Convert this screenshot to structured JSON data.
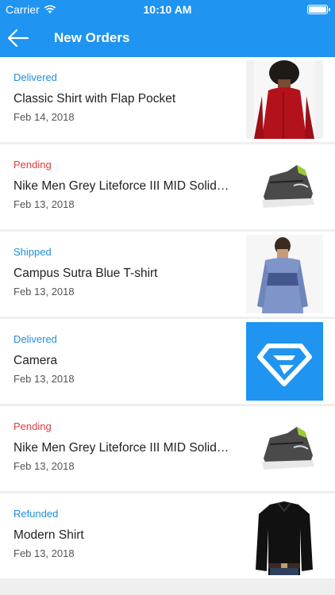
{
  "status_bar": {
    "carrier": "Carrier",
    "time": "10:10 AM"
  },
  "header": {
    "title": "New Orders"
  },
  "colors": {
    "accent": "#1f94f0",
    "status_info": "#1f8fdc",
    "status_pending": "#e23b3b"
  },
  "orders": [
    {
      "status": "Delivered",
      "status_color": "#1f8fdc",
      "title": "Classic Shirt with Flap Pocket",
      "date": "Feb 14, 2018",
      "thumb": "red-shirt-photo"
    },
    {
      "status": "Pending",
      "status_color": "#e23b3b",
      "title": "Nike Men Grey Liteforce III MID Solid…",
      "date": "Feb 13, 2018",
      "thumb": "grey-sneaker-photo"
    },
    {
      "status": "Shipped",
      "status_color": "#1f8fdc",
      "title": "Campus Sutra Blue T-shirt",
      "date": "Feb 13, 2018",
      "thumb": "blue-tshirt-photo"
    },
    {
      "status": "Delivered",
      "status_color": "#1f8fdc",
      "title": "Camera",
      "date": "Feb 13, 2018",
      "thumb": "brand-logo-icon"
    },
    {
      "status": "Pending",
      "status_color": "#e23b3b",
      "title": "Nike Men Grey Liteforce III MID Solid…",
      "date": "Feb 13, 2018",
      "thumb": "grey-sneaker-photo"
    },
    {
      "status": "Refunded",
      "status_color": "#1f8fdc",
      "title": "Modern Shirt",
      "date": "Feb 13, 2018",
      "thumb": "black-shirt-photo"
    }
  ]
}
